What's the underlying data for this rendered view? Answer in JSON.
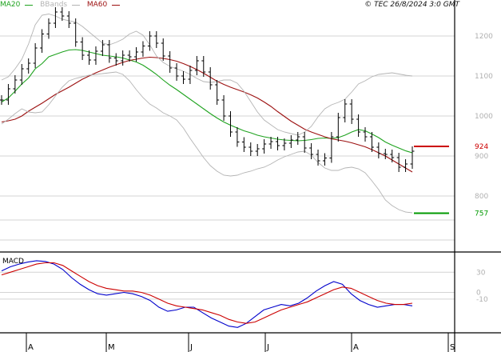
{
  "legend": {
    "ma20": {
      "label": "MA20",
      "color": "#1fa31f"
    },
    "bbands": {
      "label": "BBands",
      "color": "#b4b4b4"
    },
    "ma60": {
      "label": "MA60",
      "color": "#9c1010"
    }
  },
  "copyright": "© TEC 26/8/2024 3:0 GMT",
  "macd_label": "MACD",
  "chart_data": [
    {
      "type": "line",
      "title": "",
      "x_tick_labels": [
        "A",
        "M",
        "J",
        "J",
        "A",
        "S"
      ],
      "y_ticks": [
        1200,
        1100,
        1000,
        900,
        800
      ],
      "ylim": [
        660,
        1290
      ],
      "grid": true,
      "levels": [
        {
          "label": "924",
          "value": 924,
          "color": "#cc0000"
        },
        {
          "label": "757",
          "value": 757,
          "color": "#009900"
        }
      ],
      "series": [
        {
          "name": "MA20",
          "color": "#1fa31f",
          "values": [
            1035,
            1045,
            1062,
            1080,
            1095,
            1118,
            1131,
            1148,
            1154,
            1160,
            1165,
            1166,
            1164,
            1160,
            1156,
            1152,
            1150,
            1148,
            1145,
            1140,
            1135,
            1127,
            1116,
            1104,
            1090,
            1077,
            1066,
            1054,
            1042,
            1030,
            1018,
            1006,
            995,
            985,
            977,
            970,
            963,
            958,
            952,
            948,
            945,
            942,
            940,
            939,
            938,
            939,
            941,
            944,
            945,
            944,
            946,
            952,
            960,
            966,
            963,
            955,
            946,
            935,
            927,
            920,
            913,
            908
          ]
        },
        {
          "name": "MA60",
          "color": "#9c1010",
          "values": [
            985,
            988,
            992,
            1000,
            1012,
            1022,
            1032,
            1043,
            1054,
            1063,
            1072,
            1082,
            1092,
            1100,
            1108,
            1115,
            1122,
            1128,
            1134,
            1139,
            1142,
            1145,
            1147,
            1146,
            1144,
            1141,
            1137,
            1131,
            1124,
            1116,
            1107,
            1097,
            1087,
            1079,
            1072,
            1066,
            1060,
            1053,
            1045,
            1035,
            1024,
            1011,
            999,
            987,
            977,
            967,
            960,
            954,
            948,
            943,
            940,
            937,
            933,
            928,
            923,
            916,
            908,
            900,
            890,
            880,
            870,
            860
          ]
        },
        {
          "name": "BBands upper",
          "color": "#b4b4b4",
          "values": [
            1090,
            1098,
            1118,
            1142,
            1180,
            1228,
            1252,
            1255,
            1250,
            1242,
            1238,
            1235,
            1224,
            1210,
            1196,
            1182,
            1178,
            1184,
            1192,
            1205,
            1212,
            1202,
            1178,
            1150,
            1134,
            1124,
            1118,
            1112,
            1104,
            1094,
            1086,
            1084,
            1086,
            1090,
            1090,
            1082,
            1062,
            1036,
            1010,
            990,
            978,
            966,
            960,
            956,
            952,
            960,
            974,
            998,
            1018,
            1028,
            1034,
            1042,
            1060,
            1080,
            1088,
            1098,
            1104,
            1106,
            1108,
            1105,
            1102,
            1100
          ]
        },
        {
          "name": "BBands lower",
          "color": "#b4b4b4",
          "values": [
            980,
            992,
            1006,
            1018,
            1010,
            1008,
            1010,
            1028,
            1050,
            1072,
            1088,
            1094,
            1098,
            1102,
            1104,
            1106,
            1108,
            1110,
            1104,
            1088,
            1066,
            1046,
            1030,
            1020,
            1008,
            1000,
            990,
            970,
            944,
            920,
            896,
            876,
            862,
            852,
            850,
            852,
            858,
            862,
            868,
            872,
            880,
            890,
            898,
            904,
            910,
            912,
            902,
            884,
            870,
            864,
            864,
            870,
            872,
            868,
            858,
            838,
            816,
            790,
            776,
            766,
            760,
            758
          ]
        },
        {
          "name": "Price",
          "color": "#000000",
          "values": [
            1040,
            1068,
            1090,
            1118,
            1132,
            1170,
            1205,
            1232,
            1260,
            1250,
            1232,
            1185,
            1152,
            1140,
            1162,
            1178,
            1145,
            1138,
            1152,
            1148,
            1160,
            1175,
            1200,
            1182,
            1150,
            1120,
            1100,
            1092,
            1114,
            1138,
            1110,
            1078,
            1040,
            1000,
            960,
            935,
            922,
            912,
            918,
            930,
            936,
            926,
            932,
            940,
            948,
            920,
            904,
            888,
            895,
            948,
            996,
            1030,
            992,
            960,
            948,
            922,
            906,
            904,
            896,
            872,
            880,
            912
          ]
        }
      ]
    },
    {
      "type": "line",
      "title": "",
      "y_ticks": [
        30,
        0,
        -10
      ],
      "ylim": [
        -60,
        60
      ],
      "grid": true,
      "series": [
        {
          "name": "",
          "color": "#0000cc",
          "values": [
            32,
            38,
            42,
            45,
            47,
            46,
            42,
            34,
            22,
            12,
            4,
            -2,
            -4,
            -2,
            0,
            -2,
            -6,
            -12,
            -22,
            -28,
            -26,
            -22,
            -22,
            -30,
            -38,
            -44,
            -50,
            -52,
            -46,
            -36,
            -26,
            -22,
            -18,
            -20,
            -16,
            -8,
            2,
            10,
            16,
            12,
            -2,
            -12,
            -18,
            -22,
            -20,
            -18,
            -18,
            -20
          ]
        },
        {
          "name": "",
          "color": "#cc0000",
          "values": [
            26,
            30,
            34,
            38,
            42,
            44,
            44,
            40,
            32,
            24,
            16,
            10,
            6,
            4,
            2,
            2,
            0,
            -4,
            -10,
            -16,
            -20,
            -22,
            -24,
            -26,
            -30,
            -34,
            -40,
            -44,
            -46,
            -44,
            -38,
            -32,
            -26,
            -22,
            -18,
            -14,
            -8,
            -2,
            4,
            8,
            6,
            0,
            -6,
            -12,
            -16,
            -18,
            -18,
            -16
          ]
        }
      ]
    }
  ]
}
